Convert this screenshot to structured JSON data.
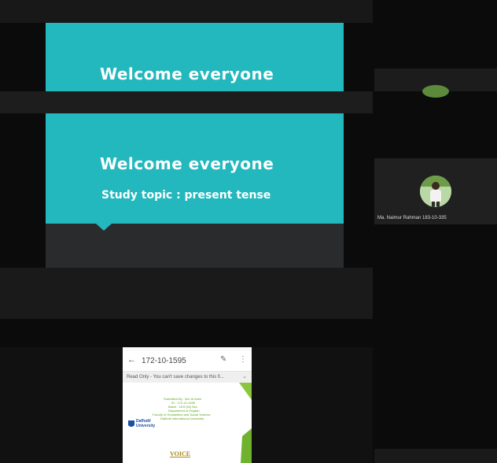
{
  "slide": {
    "title": "Welcome everyone",
    "subtitle": "Study topic : present tense",
    "accent": "#23b8bd"
  },
  "participant": {
    "name": "Ma. Naimur Rahman 183-10-335"
  },
  "phone": {
    "back_icon": "arrow-left-icon",
    "title": "172-10-1595",
    "edit_icon": "pencil-icon",
    "more_icon": "kebab-menu-icon",
    "readonly_notice": "Read Only - You can't save changes to this fi...",
    "expand_icon": "chevron-down-icon",
    "doc_lines": [
      "Submitted By : Md. Al Amin",
      "ID : 172-10-1595",
      "Batch : 18 B (M) Sec",
      "Department of English",
      "Faculty of Humanities and Social Science",
      "Daffodil International University"
    ],
    "university_logo_text": "Daffodil University",
    "voice_heading": "VOICE"
  }
}
